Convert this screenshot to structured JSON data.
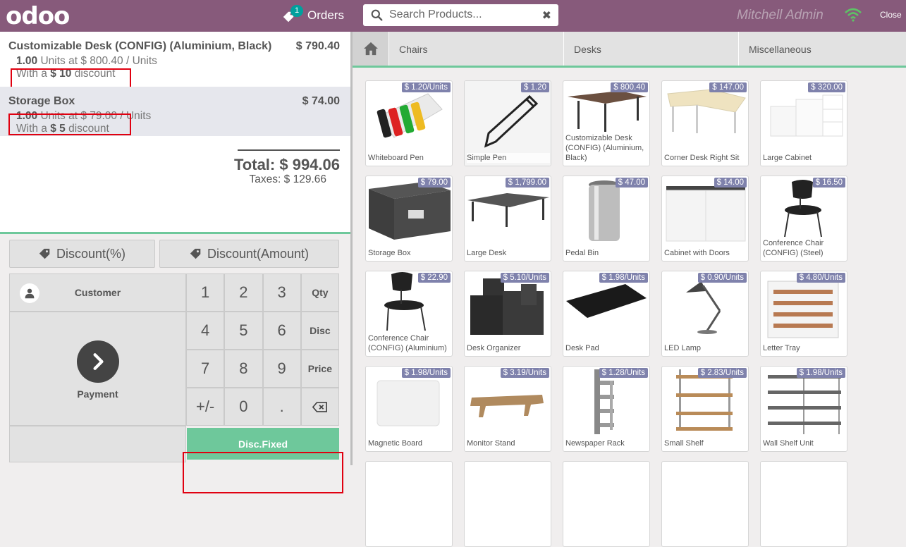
{
  "header": {
    "logo": "odoo",
    "orders_label": "Orders",
    "orders_count": "1",
    "search_placeholder": "Search Products...",
    "user_name": "Mitchell Admin",
    "close_label": "Close",
    "brand_color": "#875a7b"
  },
  "order": {
    "lines": [
      {
        "name": "Customizable Desk (CONFIG) (Aluminium, Black)",
        "price": "$ 790.40",
        "qty": "1.00",
        "unit_info": " Units at $ 800.40 / Units",
        "disc_prefix": "With a ",
        "disc_value": "$ 10",
        "disc_suffix": " discount"
      },
      {
        "name": "Storage Box",
        "price": "$ 74.00",
        "qty": "1.00",
        "unit_info": " Units at $ 79.00 / Units",
        "disc_prefix": "With a ",
        "disc_value": "$ 5",
        "disc_suffix": " discount"
      }
    ],
    "total": "Total: $ 994.06",
    "taxes": "Taxes: $ 129.66"
  },
  "controls": {
    "discount_pct": "Discount(%)",
    "discount_amount": "Discount(Amount)"
  },
  "numpad": {
    "customer": "Customer",
    "payment": "Payment",
    "keys": [
      "1",
      "2",
      "3",
      "Qty",
      "4",
      "5",
      "6",
      "Disc",
      "7",
      "8",
      "9",
      "Price",
      "+/-",
      "0",
      "."
    ],
    "disc_fixed": "Disc.Fixed",
    "accent_color": "#6ec89b"
  },
  "categories": [
    "Chairs",
    "Desks",
    "Miscellaneous"
  ],
  "products": [
    {
      "name": "Whiteboard Pen",
      "price": "$ 1.20/Units",
      "icon": "whiteboard-pen"
    },
    {
      "name": "Simple Pen",
      "price": "$ 1.20",
      "icon": "pen"
    },
    {
      "name": "Customizable Desk (CONFIG) (Aluminium, Black)",
      "price": "$ 800.40",
      "icon": "desk"
    },
    {
      "name": "Corner Desk Right Sit",
      "price": "$ 147.00",
      "icon": "corner-desk"
    },
    {
      "name": "Large Cabinet",
      "price": "$ 320.00",
      "icon": "cabinet"
    },
    {
      "name": "Storage Box",
      "price": "$ 79.00",
      "icon": "storage-box"
    },
    {
      "name": "Large Desk",
      "price": "$ 1,799.00",
      "icon": "large-desk"
    },
    {
      "name": "Pedal Bin",
      "price": "$ 47.00",
      "icon": "bin"
    },
    {
      "name": "Cabinet with Doors",
      "price": "$ 14.00",
      "icon": "cabinet-doors"
    },
    {
      "name": "Conference Chair (CONFIG) (Steel)",
      "price": "$ 16.50",
      "icon": "chair"
    },
    {
      "name": "Conference Chair (CONFIG) (Aluminium)",
      "price": "$ 22.90",
      "icon": "chair"
    },
    {
      "name": "Desk Organizer",
      "price": "$ 5.10/Units",
      "icon": "organizer"
    },
    {
      "name": "Desk Pad",
      "price": "$ 1.98/Units",
      "icon": "desk-pad"
    },
    {
      "name": "LED Lamp",
      "price": "$ 0.90/Units",
      "icon": "lamp"
    },
    {
      "name": "Letter Tray",
      "price": "$ 4.80/Units",
      "icon": "letter-tray"
    },
    {
      "name": "Magnetic Board",
      "price": "$ 1.98/Units",
      "icon": "board"
    },
    {
      "name": "Monitor Stand",
      "price": "$ 3.19/Units",
      "icon": "monitor-stand"
    },
    {
      "name": "Newspaper Rack",
      "price": "$ 1.28/Units",
      "icon": "rack"
    },
    {
      "name": "Small Shelf",
      "price": "$ 2.83/Units",
      "icon": "small-shelf"
    },
    {
      "name": "Wall Shelf Unit",
      "price": "$ 1.98/Units",
      "icon": "wall-shelf"
    }
  ]
}
